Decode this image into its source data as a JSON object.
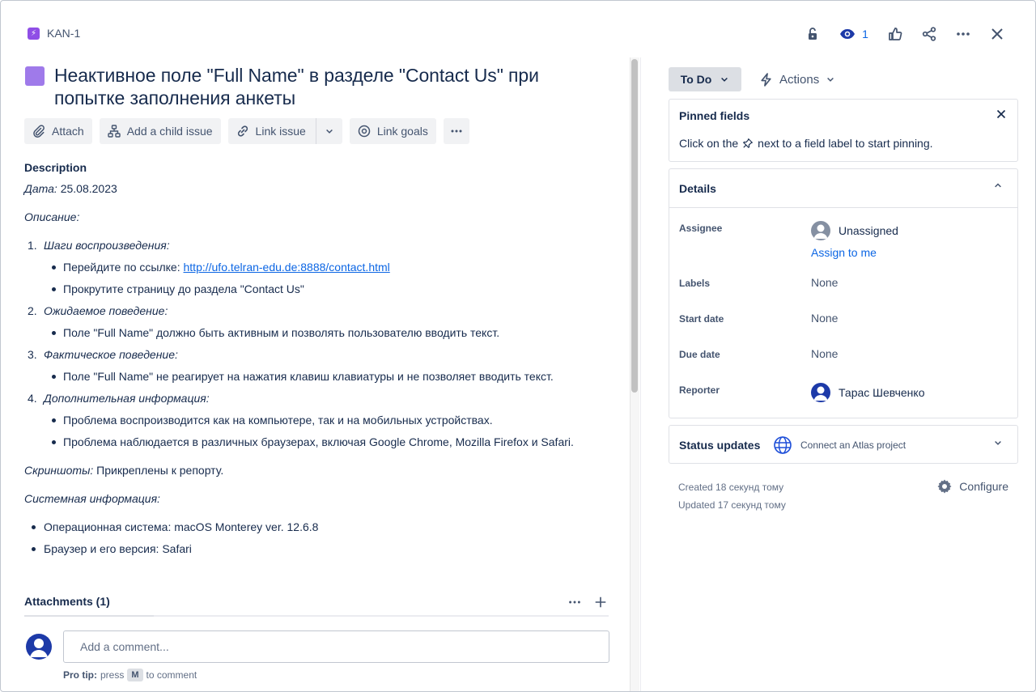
{
  "header": {
    "issue_key": "KAN-1",
    "watch_count": "1"
  },
  "issue": {
    "title": "Неактивное поле \"Full Name\" в разделе \"Contact Us\" при попытке заполнения анкеты"
  },
  "toolbar": {
    "attach": "Attach",
    "add_child": "Add a child issue",
    "link_issue": "Link issue",
    "link_goals": "Link goals"
  },
  "description": {
    "heading": "Description",
    "date_label": "Дата:",
    "date_value": " 25.08.2023",
    "desc_label": "Описание:",
    "steps": [
      {
        "num": "1.",
        "label": "Шаги воспроизведения:",
        "items": [
          {
            "text": "Перейдите по ссылке: ",
            "link": "http://ufo.telran-edu.de:8888/contact.html"
          },
          {
            "text": "Прокрутите страницу до раздела \"Contact Us\""
          }
        ]
      },
      {
        "num": "2.",
        "label": "Ожидаемое поведение:",
        "items": [
          {
            "text": "Поле \"Full Name\" должно быть активным и позволять пользователю вводить текст."
          }
        ]
      },
      {
        "num": "3.",
        "label": "Фактическое поведение:",
        "items": [
          {
            "text": "Поле \"Full Name\" не реагирует на нажатия клавиш клавиатуры и не позволяет вводить текст."
          }
        ]
      },
      {
        "num": "4.",
        "label": "Дополнительная информация:",
        "items": [
          {
            "text": "Проблема воспроизводится как на компьютере, так и на мобильных устройствах."
          },
          {
            "text": "Проблема наблюдается в различных браузерах, включая Google Chrome, Mozilla Firefox и Safari."
          }
        ]
      }
    ],
    "screenshots_label": "Скриншоты:",
    "screenshots_value": " Прикреплены к репорту.",
    "sysinfo_label": "Системная информация:",
    "sysinfo": [
      "Операционная система: macOS Monterey ver. 12.6.8",
      "Браузер и его версия: Safari"
    ]
  },
  "attachments": {
    "heading": "Attachments (1)"
  },
  "comment": {
    "placeholder": "Add a comment...",
    "protip_bold": "Pro tip:",
    "protip_pre": " press ",
    "protip_key": "M",
    "protip_post": " to comment"
  },
  "sidebar": {
    "status": "To Do",
    "actions": "Actions",
    "pinned": {
      "heading": "Pinned fields",
      "text_pre": "Click on the",
      "text_post": "next to a field label to start pinning."
    },
    "details": {
      "heading": "Details",
      "assignee_label": "Assignee",
      "assignee_value": "Unassigned",
      "assign_to_me": "Assign to me",
      "labels_label": "Labels",
      "labels_value": "None",
      "start_label": "Start date",
      "start_value": "None",
      "due_label": "Due date",
      "due_value": "None",
      "reporter_label": "Reporter",
      "reporter_value": "Тарас Шевченко"
    },
    "status_updates": {
      "heading": "Status updates",
      "atlas": "Connect an Atlas project"
    },
    "created": "Created 18 секунд тому",
    "updated": "Updated 17 секунд тому",
    "configure": "Configure"
  },
  "colors": {
    "accent": "#0c66e4",
    "issue_type": "#8f4ee6"
  }
}
